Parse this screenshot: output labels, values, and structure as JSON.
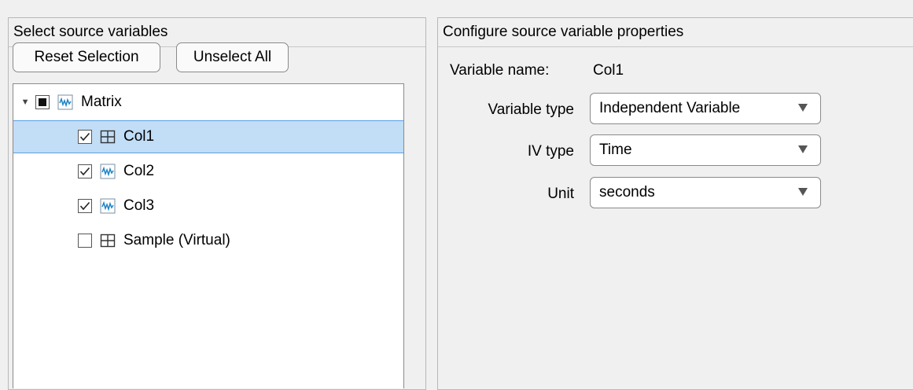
{
  "left_panel": {
    "title": "Select source variables",
    "reset_button": "Reset Selection",
    "unselect_button": "Unselect All",
    "tree": {
      "root": {
        "label": "Matrix",
        "icon": "signal-icon",
        "state": "partial",
        "expanded": true
      },
      "children": [
        {
          "label": "Col1",
          "icon": "table-icon",
          "checked": true,
          "selected": true
        },
        {
          "label": "Col2",
          "icon": "signal-icon",
          "checked": true,
          "selected": false
        },
        {
          "label": "Col3",
          "icon": "signal-icon",
          "checked": true,
          "selected": false
        },
        {
          "label": "Sample (Virtual)",
          "icon": "table-icon",
          "checked": false,
          "selected": false
        }
      ]
    }
  },
  "right_panel": {
    "title": "Configure source variable properties",
    "variable_name_label": "Variable name:",
    "variable_name_value": "Col1",
    "variable_type_label": "Variable type",
    "variable_type_value": "Independent Variable",
    "iv_type_label": "IV type",
    "iv_type_value": "Time",
    "unit_label": "Unit",
    "unit_value": "seconds"
  },
  "colors": {
    "selection_bg": "#c2ddf6",
    "selection_border": "#5aa1e3",
    "signal_icon": "#1d84c7"
  }
}
